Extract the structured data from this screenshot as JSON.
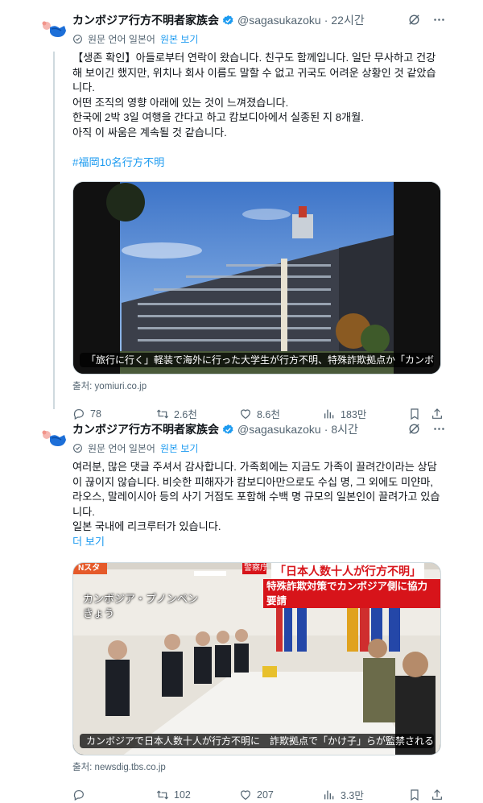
{
  "tweets": [
    {
      "author_name": "カンボジア行方不明者家族会",
      "handle": "@sagasukazoku",
      "separator": "·",
      "time": "22시간",
      "translated_from": "원문 언어 일본어",
      "show_original": "원본 보기",
      "text": "【생존 확인】아들로부터 연락이 왔습니다. 친구도 함께입니다. 일단 무사하고 건강해 보이긴 했지만, 위치나 회사 이름도 말할 수 없고 귀국도 어려운 상황인 것 같았습니다.\n어떤 조직의 영향 아래에 있는 것이 느껴졌습니다.\n한국에 2박 3일 여행을 간다고 하고 캄보디아에서 실종된 지 8개월.\n아직 이 싸움은 계속될 것 같습니다.",
      "hashtag": "#福岡10名行方不明",
      "media_caption": "「旅行に行く」軽装で海外に行った大学生が行方不明、特殊詐欺拠点か「カンボ…",
      "source": "출처: yomiuri.co.jp",
      "replies": "78",
      "retweets": "2.6천",
      "likes": "8.6천",
      "views": "183만"
    },
    {
      "author_name": "カンボジア行方不明者家族会",
      "handle": "@sagasukazoku",
      "separator": "·",
      "time": "8시간",
      "translated_from": "원문 언어 일본어",
      "show_original": "원본 보기",
      "text": "여러분, 많은 댓글 주셔서 감사합니다. 가족회에는 지금도 가족이 끌려간이라는 상담이 끊이지 않습니다. 비슷한 피해자가 캄보디아만으로도 수십 명, 그 외에도 미얀마, 라오스, 말레이시아 등의 사기 거점도 포함해 수백 명 규모의 일본인이 끌려가고 있습니다.\n일본 국내에 리크루터가 있습니다.",
      "more": "더 보기",
      "media_tag": "Nスタ",
      "media_headline_red": "「日本人数十人が行方不明」",
      "media_headline_sub": "特殊詐欺対策でカンボジア側に協力要請",
      "media_agency": "警察庁",
      "media_location": "カンボジア・プノンペン\nきょう",
      "media_caption": "カンボジアで日本人数十人が行方不明に　詐欺拠点で「かけ子」らが監禁される…",
      "source": "출처: newsdig.tbs.co.jp",
      "replies": "",
      "retweets": "102",
      "likes": "207",
      "views": "3.3만"
    }
  ],
  "colors": {
    "accent": "#1d9bf0",
    "secondary_text": "#536471",
    "verified": "#1d9bf0",
    "headline_red": "#d7141a"
  }
}
